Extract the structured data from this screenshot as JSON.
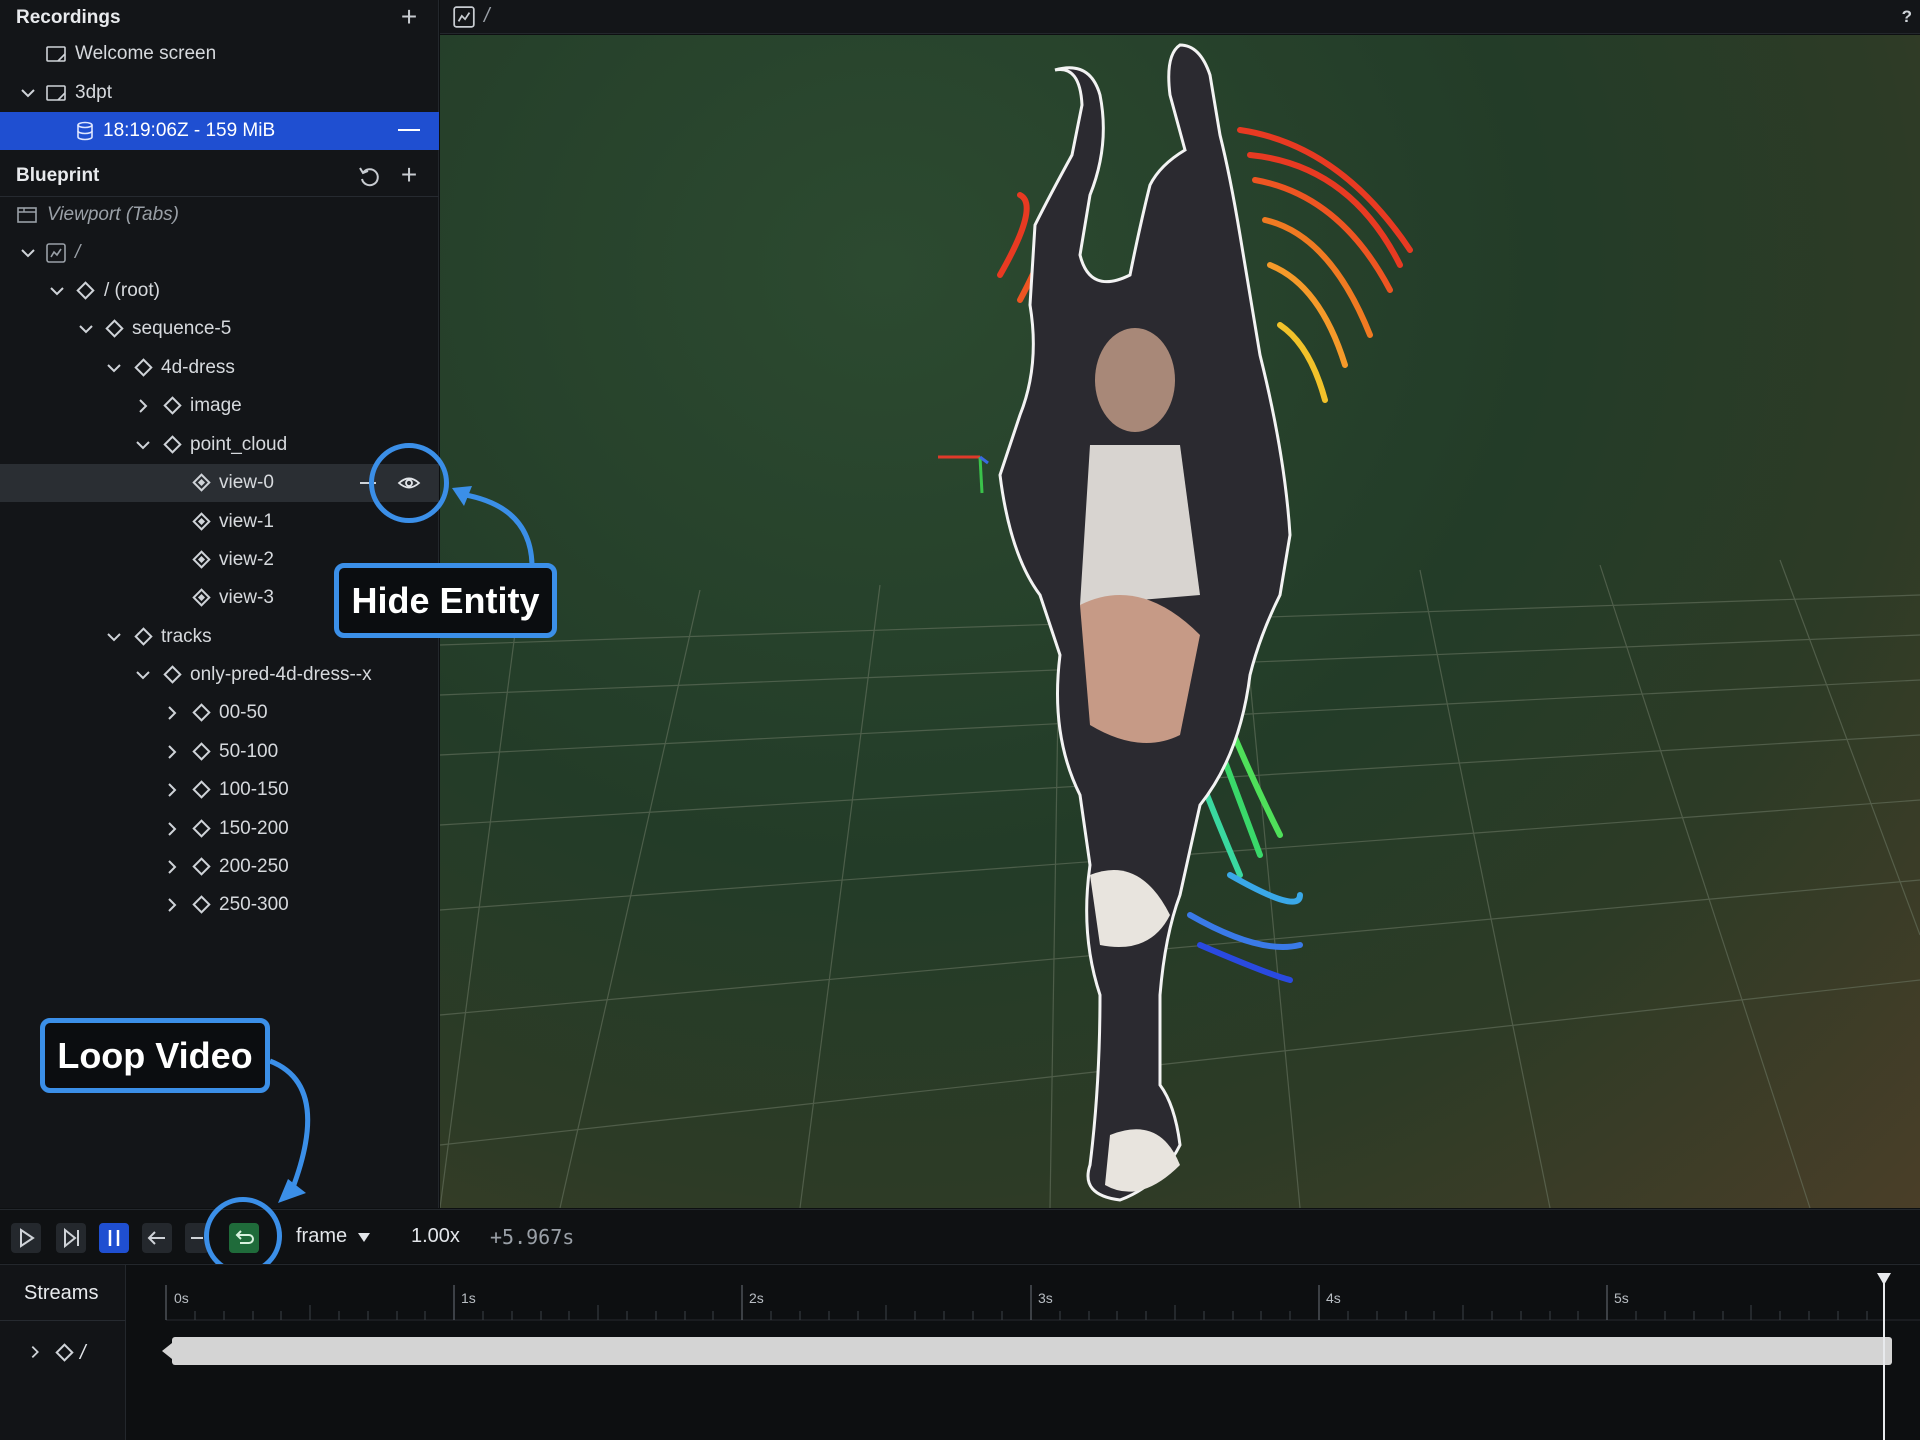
{
  "recordings": {
    "title": "Recordings",
    "add_icon": "plus-icon",
    "items": [
      {
        "label": "Welcome screen",
        "icon": "window-icon"
      },
      {
        "label": "3dpt",
        "icon": "window-icon"
      },
      {
        "label": "18:19:06Z - 159 MiB",
        "icon": "database-icon"
      }
    ]
  },
  "blueprint": {
    "title": "Blueprint",
    "reset_icon": "reset-icon",
    "add_icon": "plus-icon",
    "viewport_label": "Viewport (Tabs)",
    "tree": [
      {
        "label": "/",
        "icon": "view-icon"
      },
      {
        "label": "/ (root)",
        "icon": "diamond-icon"
      },
      {
        "label": "sequence-5",
        "icon": "diamond-icon"
      },
      {
        "label": "4d-dress",
        "icon": "diamond-icon"
      },
      {
        "label": "image",
        "icon": "diamond-icon"
      },
      {
        "label": "point_cloud",
        "icon": "diamond-icon"
      },
      {
        "label": "view-0",
        "icon": "diamond-filled-icon"
      },
      {
        "label": "view-1",
        "icon": "diamond-filled-icon"
      },
      {
        "label": "view-2",
        "icon": "diamond-filled-icon"
      },
      {
        "label": "view-3",
        "icon": "diamond-filled-icon"
      },
      {
        "label": "tracks",
        "icon": "diamond-icon"
      },
      {
        "label": "only-pred-4d-dress--x",
        "icon": "diamond-icon"
      },
      {
        "label": "00-50",
        "icon": "diamond-icon"
      },
      {
        "label": "50-100",
        "icon": "diamond-icon"
      },
      {
        "label": "100-150",
        "icon": "diamond-icon"
      },
      {
        "label": "150-200",
        "icon": "diamond-icon"
      },
      {
        "label": "200-250",
        "icon": "diamond-icon"
      },
      {
        "label": "250-300",
        "icon": "diamond-icon"
      }
    ]
  },
  "viewport": {
    "breadcrumb": "/",
    "help": "?"
  },
  "callouts": {
    "hide_entity": "Hide Entity",
    "loop_video": "Loop Video"
  },
  "playback": {
    "timeline_selector": "frame",
    "speed": "1.00x",
    "offset": "+5.967s"
  },
  "timeline": {
    "streams_label": "Streams",
    "root_label": "/",
    "ticks": [
      "0s",
      "1s",
      "2s",
      "3s",
      "4s",
      "5s"
    ]
  },
  "colors": {
    "accent": "#3b8fe8",
    "selection": "#1f4fd1",
    "loop_active": "#1f6b3a"
  }
}
